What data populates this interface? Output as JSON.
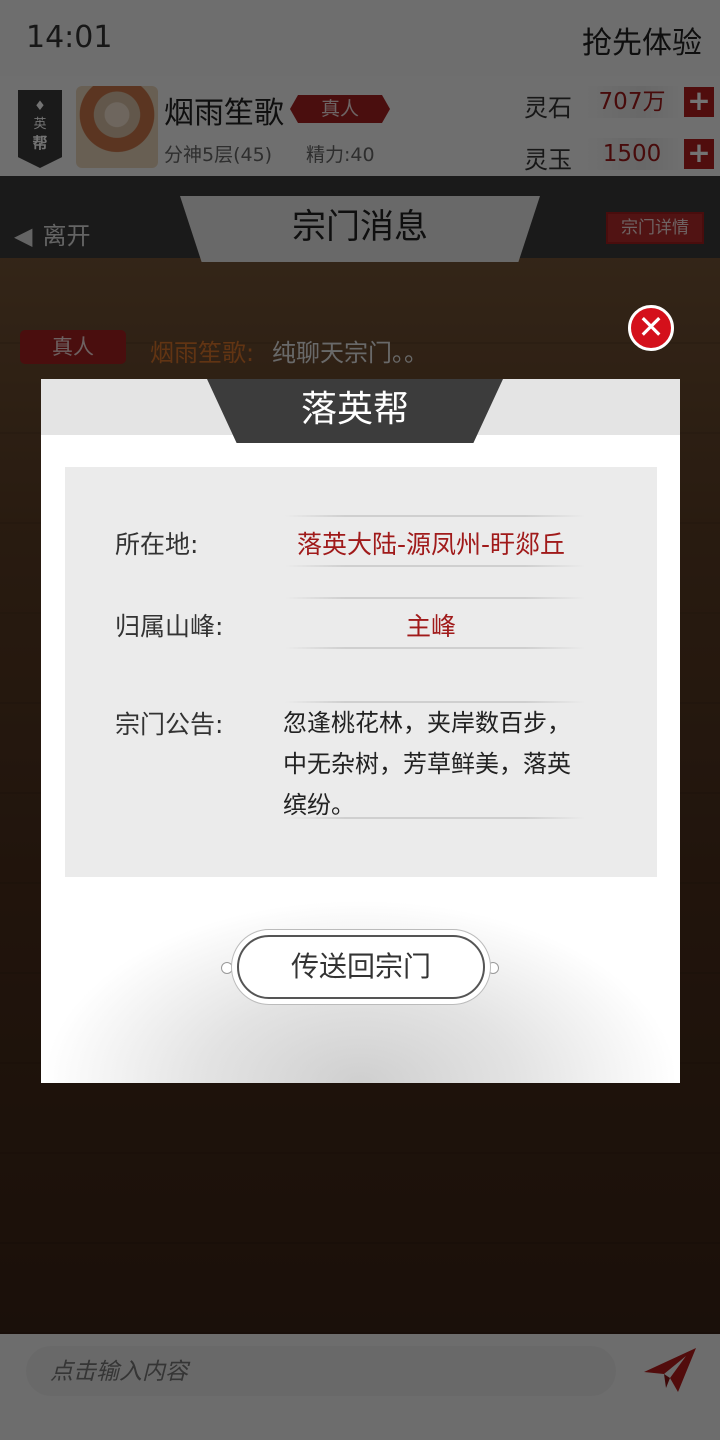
{
  "status": {
    "time": "14:01",
    "early_access": "抢先体验"
  },
  "player": {
    "banner_small": "英",
    "banner_big": "帮",
    "name": "烟雨笙歌",
    "rank": "真人",
    "level": "分神5层(45)",
    "energy": "精力:40"
  },
  "resources": [
    {
      "label": "灵石",
      "value": "707万"
    },
    {
      "label": "灵玉",
      "value": "1500"
    }
  ],
  "nav": {
    "back_label": "离开",
    "title": "宗门消息",
    "details_label": "宗门详情"
  },
  "message": {
    "rank": "真人",
    "sender": "烟雨笙歌:",
    "text": "纯聊天宗门。。"
  },
  "modal": {
    "title": "落英帮",
    "location_label": "所在地:",
    "location_value": "落英大陆-源凤州-盱郯丘",
    "peak_label": "归属山峰:",
    "peak_value": "主峰",
    "notice_label": "宗门公告:",
    "notice_text": "忽逢桃花林，夹岸数百步，中无杂树，芳草鲜美，落英缤纷。",
    "teleport_label": "传送回宗门",
    "close_symbol": "✕"
  },
  "input": {
    "placeholder": "点击输入内容"
  },
  "icons": {
    "back": "back-arrow-icon",
    "send": "paper-plane-icon",
    "close": "close-icon",
    "plus": "plus-icon"
  },
  "colors": {
    "accent_red": "#a41f1f",
    "close_red": "#d4101b",
    "sender_orange": "#d8742b"
  }
}
